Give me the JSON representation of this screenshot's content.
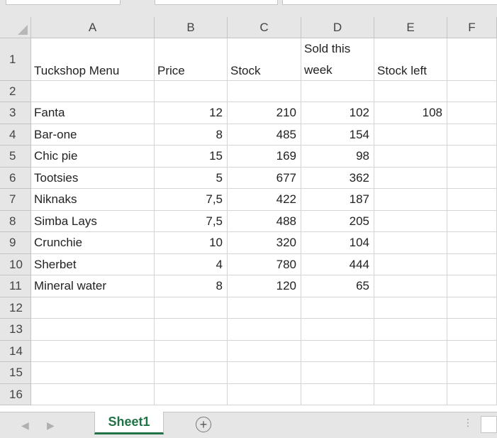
{
  "columns": [
    "A",
    "B",
    "C",
    "D",
    "E",
    "F"
  ],
  "rows": [
    "1",
    "2",
    "3",
    "4",
    "5",
    "6",
    "7",
    "8",
    "9",
    "10",
    "11",
    "12",
    "13",
    "14",
    "15",
    "16"
  ],
  "header_row": {
    "A": "Tuckshop Menu",
    "B": "Price",
    "C": "Stock",
    "D": "Sold this week",
    "E": "Stock left"
  },
  "items": [
    {
      "row": "3",
      "name": "Fanta",
      "price": "12",
      "stock": "210",
      "sold": "102",
      "left": "108"
    },
    {
      "row": "4",
      "name": "Bar-one",
      "price": "8",
      "stock": "485",
      "sold": "154",
      "left": ""
    },
    {
      "row": "5",
      "name": "Chic pie",
      "price": "15",
      "stock": "169",
      "sold": "98",
      "left": ""
    },
    {
      "row": "6",
      "name": "Tootsies",
      "price": "5",
      "stock": "677",
      "sold": "362",
      "left": ""
    },
    {
      "row": "7",
      "name": "Niknaks",
      "price": "7,5",
      "stock": "422",
      "sold": "187",
      "left": ""
    },
    {
      "row": "8",
      "name": "Simba Lays",
      "price": "7,5",
      "stock": "488",
      "sold": "205",
      "left": ""
    },
    {
      "row": "9",
      "name": "Crunchie",
      "price": "10",
      "stock": "320",
      "sold": "104",
      "left": ""
    },
    {
      "row": "10",
      "name": "Sherbet",
      "price": "4",
      "stock": "780",
      "sold": "444",
      "left": ""
    },
    {
      "row": "11",
      "name": "Mineral water",
      "price": "8",
      "stock": "120",
      "sold": "65",
      "left": ""
    }
  ],
  "sheet_tabs": [
    {
      "label": "Sheet1",
      "active": true
    }
  ],
  "add_sheet_glyph": "+",
  "accent_color": "#217346"
}
